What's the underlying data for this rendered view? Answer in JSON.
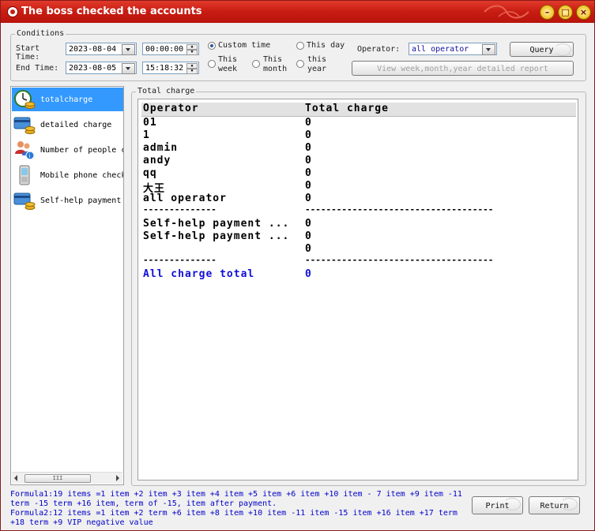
{
  "window": {
    "title": "The boss checked the accounts"
  },
  "conditions": {
    "legend": "Conditions",
    "start_label": "Start\nTime:",
    "end_label": "End Time:",
    "start_date": "2023-08-04",
    "start_time": "00:00:00",
    "end_date": "2023-08-05",
    "end_time": "15:18:32",
    "radios": {
      "custom": "Custom time",
      "this_day": "This day",
      "this_week": "This\nweek",
      "this_month": "This\nmonth",
      "this_year": "this\nyear",
      "selected": "custom"
    },
    "operator_label": "Operator:",
    "operator_value": "all operator",
    "query_button": "Query",
    "detail_button": "View week,month,year detailed report"
  },
  "nav": {
    "items": [
      {
        "label": "totalcharge",
        "icon": "clock-coins-icon",
        "selected": true
      },
      {
        "label": "detailed charge",
        "icon": "card-coins-icon",
        "selected": false
      },
      {
        "label": "Number of people c",
        "icon": "people-info-icon",
        "selected": false
      },
      {
        "label": "Mobile phone check",
        "icon": "phone-icon",
        "selected": false
      },
      {
        "label": "Self-help payment",
        "icon": "card-coins-icon",
        "selected": false
      }
    ],
    "scroll_thumb": "III"
  },
  "report": {
    "legend": "Total charge",
    "headers": {
      "operator": "Operator",
      "total": "Total charge"
    },
    "rows": [
      {
        "op": "01",
        "val": "0"
      },
      {
        "op": "1",
        "val": "0"
      },
      {
        "op": "admin",
        "val": "0"
      },
      {
        "op": "andy",
        "val": "0"
      },
      {
        "op": "qq",
        "val": "0"
      },
      {
        "op": "大王",
        "val": "0"
      },
      {
        "op": "all operator",
        "val": "0"
      }
    ],
    "sep_short": "--------------",
    "sep_long": "------------------------------------",
    "rows2": [
      {
        "op": "Self-help payment ...",
        "val": "0"
      },
      {
        "op": "Self-help payment ...",
        "val": "0"
      },
      {
        "op": "",
        "val": "0"
      }
    ],
    "total": {
      "label": "All charge total",
      "value": "0"
    }
  },
  "footer": {
    "formula1": "Formula1:19 items =1 item +2 item +3 item +4 item +5 item +6 item +10 item - 7 item +9 item -11 term -15 term +16 item, term of -15, item after payment.",
    "formula2": "Formula2:12 items =1 item +2 term +6 item +8 item +10 item -11 item -15 item +16 item +17 term +18 term +9 VIP negative value",
    "print_button": "Print",
    "return_button": "Return"
  },
  "colors": {
    "title_bar": "#c81c12",
    "selection": "#3399ff",
    "total_text": "#1010d8"
  }
}
